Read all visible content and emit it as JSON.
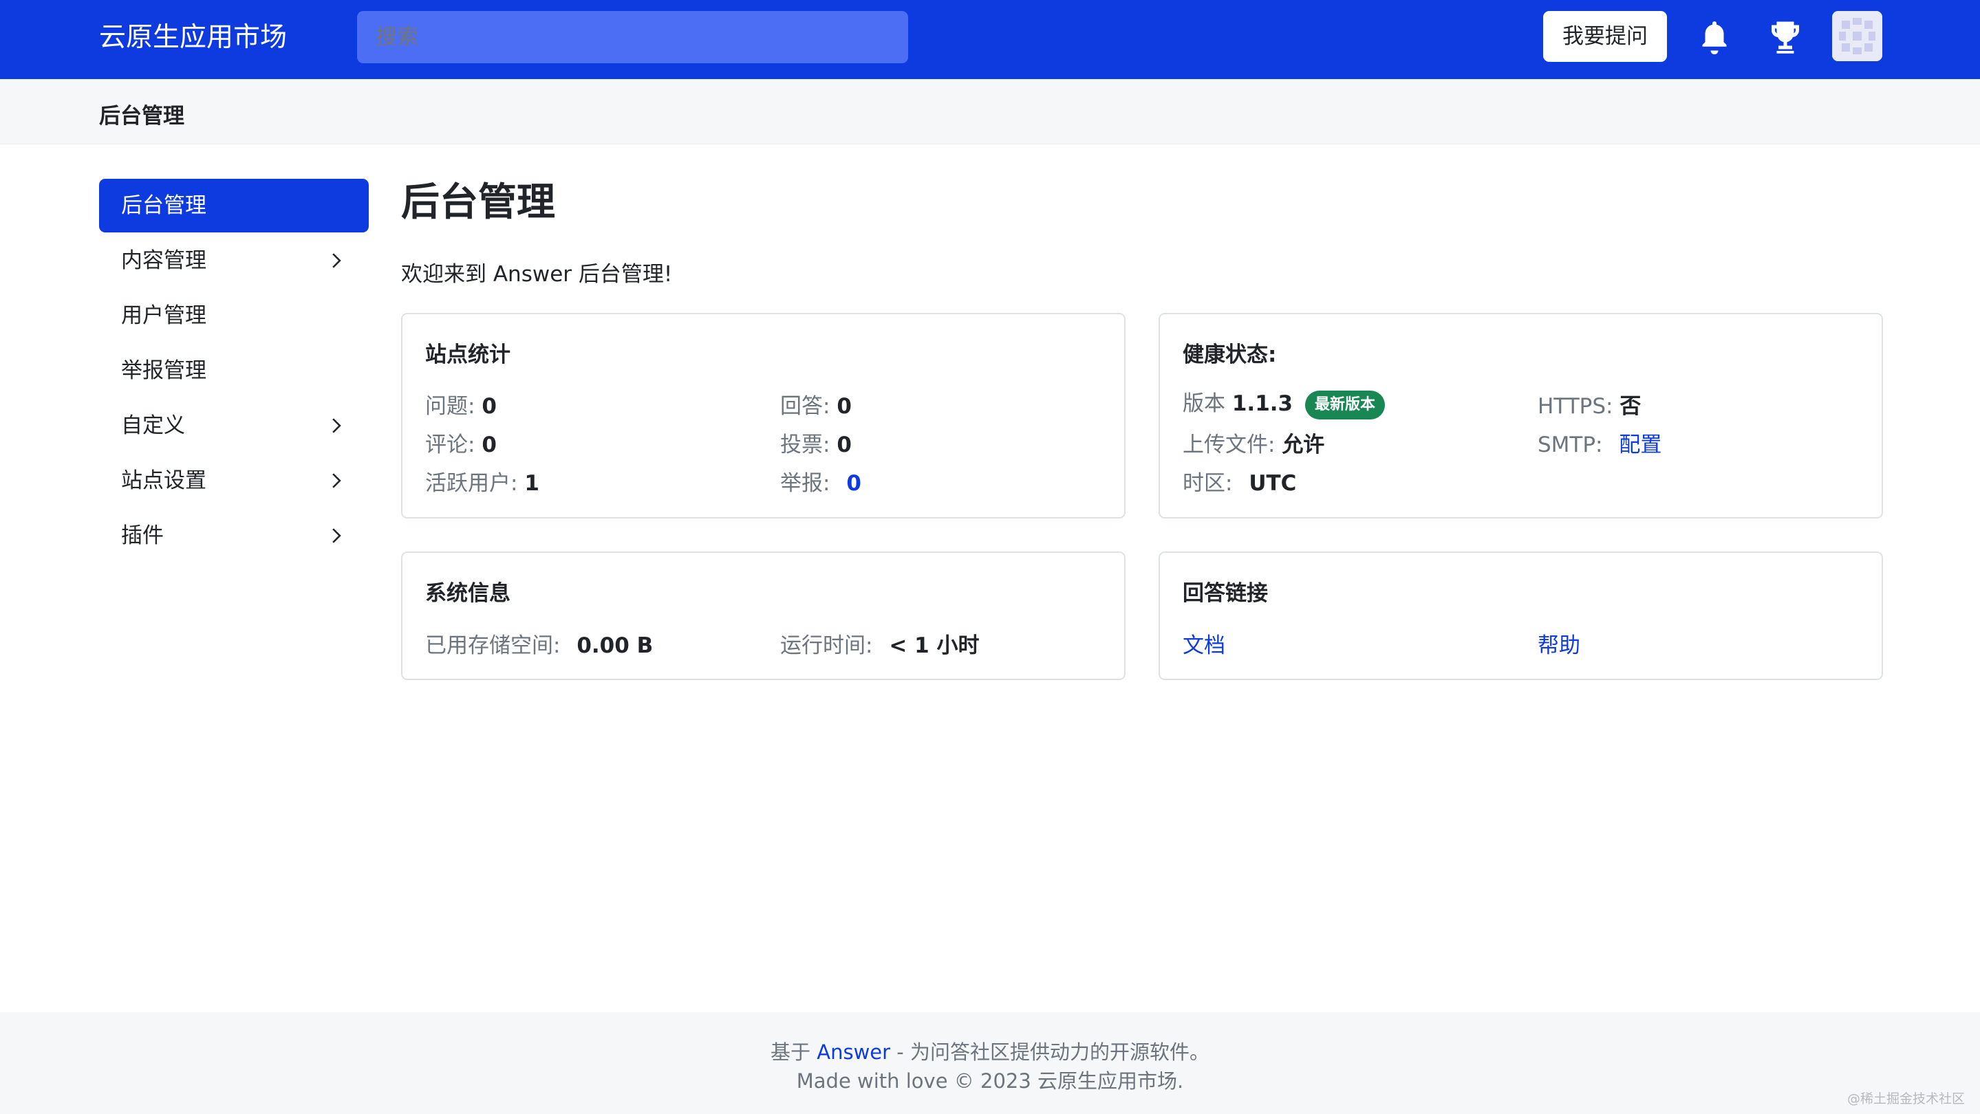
{
  "navbar": {
    "brand": "云原生应用市场",
    "search_placeholder": "搜索",
    "ask_button": "我要提问",
    "icons": [
      "bell-icon",
      "trophy-icon",
      "avatar"
    ],
    "color": "#0d3be0"
  },
  "breadcrumb": {
    "title": "后台管理"
  },
  "sidebar": {
    "items": [
      {
        "label": "后台管理",
        "active": true,
        "has_submenu": false
      },
      {
        "label": "内容管理",
        "active": false,
        "has_submenu": true
      },
      {
        "label": "用户管理",
        "active": false,
        "has_submenu": false
      },
      {
        "label": "举报管理",
        "active": false,
        "has_submenu": false
      },
      {
        "label": "自定义",
        "active": false,
        "has_submenu": true
      },
      {
        "label": "站点设置",
        "active": false,
        "has_submenu": true
      },
      {
        "label": "插件",
        "active": false,
        "has_submenu": true
      }
    ]
  },
  "main": {
    "title": "后台管理",
    "welcome": "欢迎来到 Answer 后台管理!",
    "site_stats": {
      "title": "站点统计",
      "questions_label": "问题:",
      "questions_value": "0",
      "answers_label": "回答:",
      "answers_value": "0",
      "comments_label": "评论:",
      "comments_value": "0",
      "votes_label": "投票:",
      "votes_value": "0",
      "active_users_label": "活跃用户:",
      "active_users_value": "1",
      "reports_label": "举报:",
      "reports_value": "0"
    },
    "health": {
      "title": "健康状态:",
      "version_label": "版本",
      "version_value": "1.1.3",
      "version_badge": "最新版本",
      "https_label": "HTTPS:",
      "https_value": "否",
      "upload_label": "上传文件:",
      "upload_value": "允许",
      "smtp_label": "SMTP:",
      "smtp_value": "配置",
      "timezone_label": "时区:",
      "timezone_value": "UTC"
    },
    "system_info": {
      "title": "系统信息",
      "storage_label": "已用存储空间:",
      "storage_value": "0.00 B",
      "uptime_label": "运行时间:",
      "uptime_value": "< 1 小时"
    },
    "answer_links": {
      "title": "回答链接",
      "docs": "文档",
      "help": "帮助"
    }
  },
  "footer": {
    "prefix": "基于",
    "answer_link": "Answer",
    "suffix": "- 为问答社区提供动力的开源软件。",
    "line2": "Made with love © 2023 云原生应用市场."
  },
  "watermark": "@稀土掘金技术社区"
}
